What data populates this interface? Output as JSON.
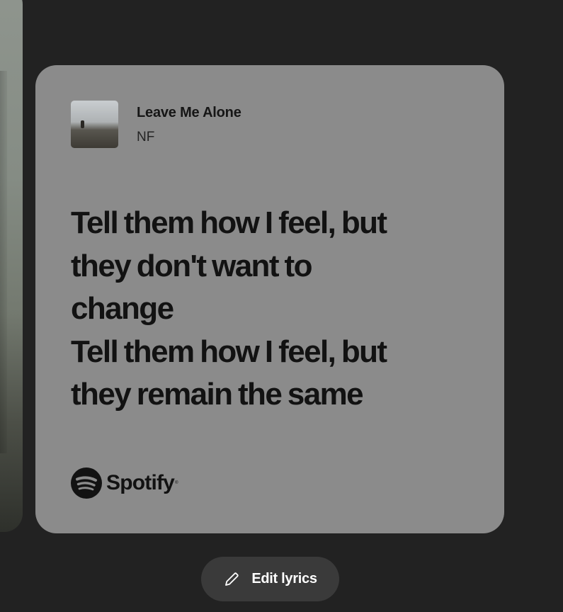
{
  "song": {
    "title": "Leave Me Alone",
    "artist": "NF"
  },
  "lyrics": {
    "lines": [
      "Tell them how I feel, but",
      "they don't want to",
      "change",
      "Tell them how I feel, but",
      "they remain the same"
    ]
  },
  "brand": {
    "name": "Spotify",
    "icon": "spotify-logo-icon"
  },
  "actions": {
    "edit_label": "Edit lyrics",
    "edit_icon": "pencil-icon"
  },
  "colors": {
    "background": "#222222",
    "card": "#8b8b8b",
    "button": "#3a3a3a"
  }
}
